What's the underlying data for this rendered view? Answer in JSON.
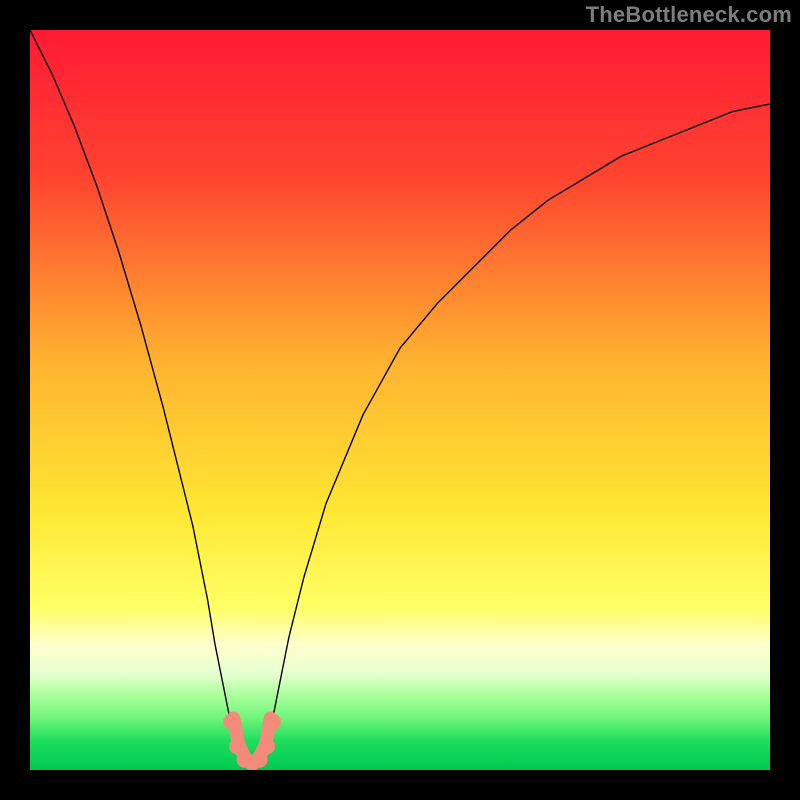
{
  "watermark": "TheBottleneck.com",
  "chart_data": {
    "type": "line",
    "title": "",
    "xlabel": "",
    "ylabel": "",
    "xlim": [
      0,
      100
    ],
    "ylim": [
      0,
      100
    ],
    "background_gradient": {
      "stops": [
        {
          "offset": 0.0,
          "color": "#ff1a34"
        },
        {
          "offset": 0.2,
          "color": "#ff4430"
        },
        {
          "offset": 0.45,
          "color": "#ffb330"
        },
        {
          "offset": 0.65,
          "color": "#ffe733"
        },
        {
          "offset": 0.78,
          "color": "#ffff66"
        },
        {
          "offset": 0.83,
          "color": "#ffffcc"
        },
        {
          "offset": 0.87,
          "color": "#e6ffd0"
        },
        {
          "offset": 0.9,
          "color": "#a9ff9a"
        },
        {
          "offset": 0.93,
          "color": "#6ff57a"
        },
        {
          "offset": 0.96,
          "color": "#1fde5e"
        },
        {
          "offset": 1.0,
          "color": "#00c853"
        }
      ]
    },
    "series": [
      {
        "name": "bottleneck-curve",
        "color": "#000000",
        "stroke_width": 1.4,
        "x": [
          0,
          3,
          6,
          9,
          12,
          15,
          18,
          20,
          22,
          24,
          25,
          26,
          27,
          28,
          29,
          30,
          31,
          32,
          33,
          34,
          35,
          37,
          40,
          45,
          50,
          55,
          60,
          65,
          70,
          75,
          80,
          85,
          90,
          95,
          100
        ],
        "y_pct": [
          100,
          94,
          87,
          79,
          70,
          60,
          49,
          41,
          33,
          23,
          17,
          12,
          7,
          4,
          2,
          1,
          2,
          4,
          8,
          13,
          18,
          26,
          36,
          48,
          57,
          63,
          68,
          73,
          77,
          80,
          83,
          85,
          87,
          89,
          90
        ]
      }
    ],
    "salmon_marker": {
      "color": "#f48a7a",
      "dot_radius_pct": 1.1,
      "arc_stroke_pct": 1.8,
      "dots_x": [
        27.2,
        28.0,
        29.0,
        30.0,
        31.0,
        32.0,
        32.8
      ],
      "dots_y": [
        6.5,
        3.2,
        1.4,
        1.0,
        1.4,
        3.2,
        6.5
      ],
      "arc_path_points": [
        {
          "x": 27.5,
          "y": 7.0
        },
        {
          "x": 28.2,
          "y": 3.4
        },
        {
          "x": 29.2,
          "y": 1.4
        },
        {
          "x": 30.0,
          "y": 1.0
        },
        {
          "x": 30.8,
          "y": 1.4
        },
        {
          "x": 31.8,
          "y": 3.4
        },
        {
          "x": 32.5,
          "y": 7.0
        }
      ]
    }
  }
}
